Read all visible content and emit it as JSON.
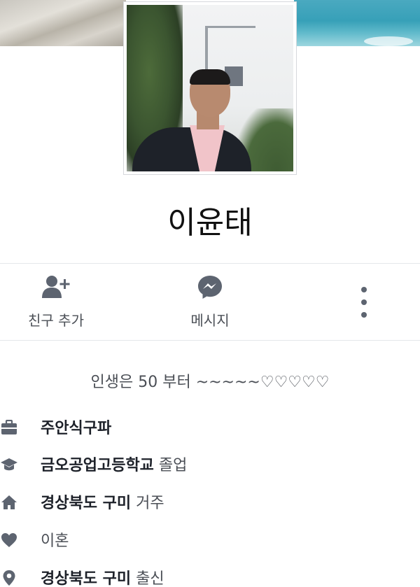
{
  "profile": {
    "name": "이윤태"
  },
  "actions": {
    "add_friend_label": "친구 추가",
    "message_label": "메시지"
  },
  "bio": "인생은 50 부터 ~~~~~♡♡♡♡♡",
  "intro": [
    {
      "icon": "briefcase-icon",
      "bold": "주안식구파",
      "rest": ""
    },
    {
      "icon": "graduation-cap-icon",
      "bold": "금오공업고등학교",
      "rest": " 졸업"
    },
    {
      "icon": "home-icon",
      "bold": "경상북도 구미",
      "rest": " 거주"
    },
    {
      "icon": "heart-icon",
      "bold": "",
      "rest": "이혼"
    },
    {
      "icon": "location-pin-icon",
      "bold": "경상북도 구미",
      "rest": " 출신"
    }
  ],
  "colors": {
    "icon_gray": "#5d6470",
    "text_primary": "#1d2129",
    "text_secondary": "#4b4f56"
  }
}
